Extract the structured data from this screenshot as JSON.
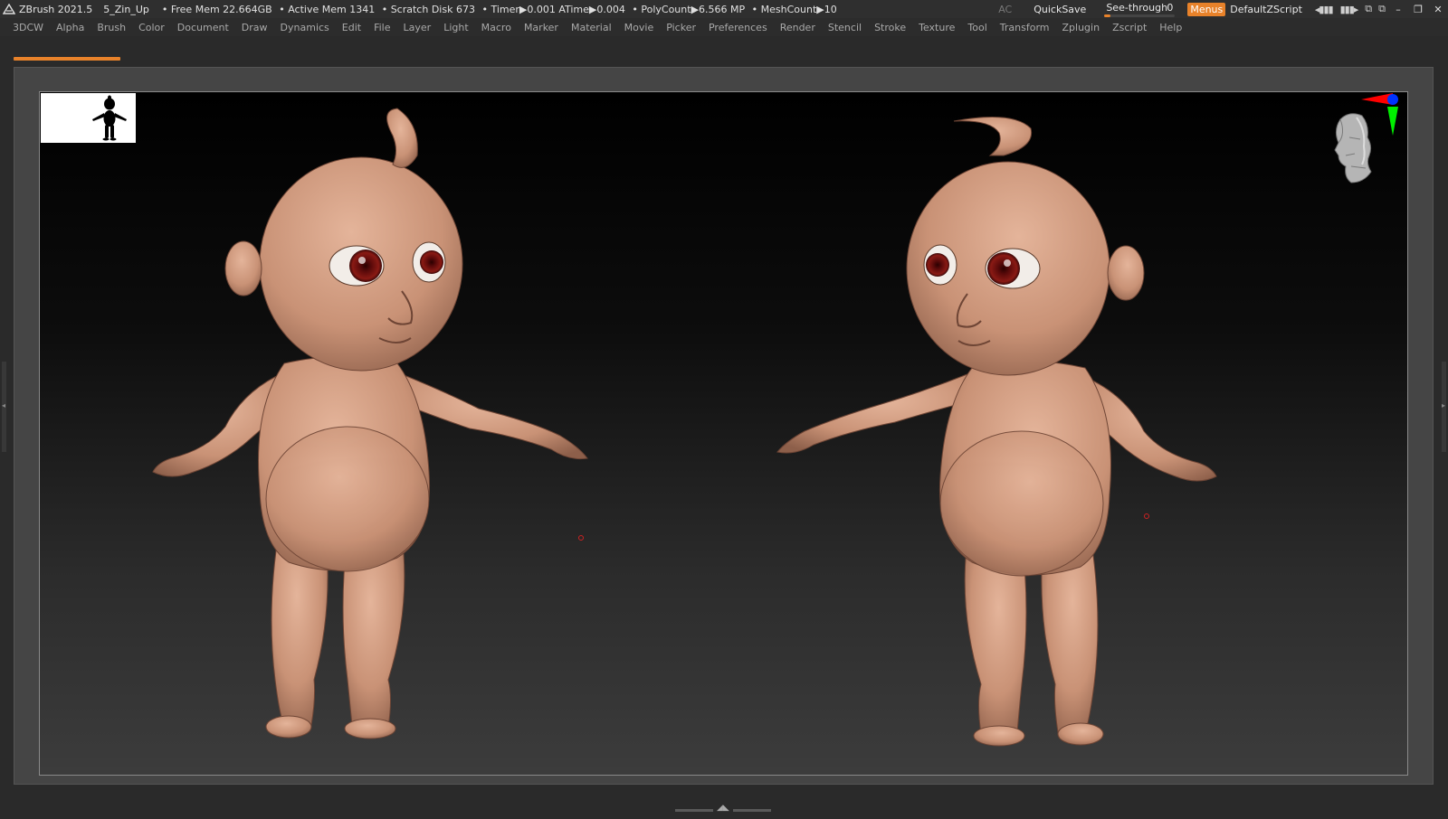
{
  "titlebar": {
    "app": "ZBrush 2021.5",
    "project": "5_Zin_Up",
    "stats": [
      "• Free Mem 22.664GB",
      "• Active Mem 1341",
      "• Scratch Disk 673",
      "• Timer▶0.001 ATime▶0.004",
      "• PolyCount▶6.566 MP",
      "• MeshCount▶10"
    ],
    "ac_label": "AC",
    "quicksave_label": "QuickSave",
    "seethrough_label": "See-through",
    "seethrough_value": "0",
    "seethrough_level": 0.02,
    "menus_label": "Menus",
    "script_label": "DefaultZScript",
    "icons": [
      "layout-left-icon",
      "layout-right-icon",
      "copy-window-icon",
      "restore-window-icon"
    ],
    "window_controls": [
      "minimize-icon",
      "maximize-icon",
      "close-icon"
    ]
  },
  "menubar": {
    "items": [
      "3DCW",
      "Alpha",
      "Brush",
      "Color",
      "Document",
      "Draw",
      "Dynamics",
      "Edit",
      "File",
      "Layer",
      "Light",
      "Macro",
      "Marker",
      "Material",
      "Movie",
      "Picker",
      "Preferences",
      "Render",
      "Stencil",
      "Stroke",
      "Texture",
      "Tool",
      "Transform",
      "Zplugin",
      "Zscript",
      "Help"
    ]
  },
  "progress": {
    "fraction": 0.075,
    "color": "#e8822a"
  },
  "viewport": {
    "models": [
      "baby-sculpt-front-left",
      "baby-sculpt-front-right"
    ],
    "skin_color": "#c99276",
    "background_top": "#000000",
    "background_bottom": "#3c3c3c"
  },
  "colors": {
    "accent": "#e8822a"
  }
}
